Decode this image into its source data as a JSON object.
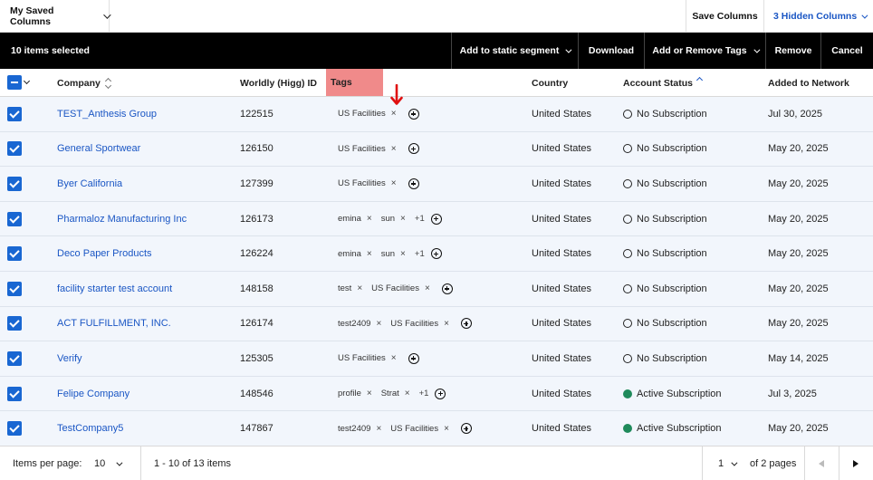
{
  "toolbar": {
    "saved_columns": "My Saved Columns",
    "save_columns": "Save Columns",
    "hidden_columns": "3 Hidden Columns"
  },
  "actionbar": {
    "selected_count": "10 items selected",
    "add_to_segment": "Add to static segment",
    "download": "Download",
    "add_remove_tags": "Add or Remove Tags",
    "remove": "Remove",
    "cancel": "Cancel"
  },
  "columns": {
    "company": "Company",
    "worldly_id": "Worldly (Higg) ID",
    "tags": "Tags",
    "country": "Country",
    "account_status": "Account Status",
    "added": "Added to Network"
  },
  "rows": [
    {
      "company": "TEST_Anthesis Group",
      "id": "122515",
      "tags": [
        "US Facilities"
      ],
      "more": "",
      "country": "United States",
      "status": "No Subscription",
      "status_type": "none",
      "added": "Jul 30, 2025"
    },
    {
      "company": "General Sportwear",
      "id": "126150",
      "tags": [
        "US Facilities"
      ],
      "more": "",
      "country": "United States",
      "status": "No Subscription",
      "status_type": "none",
      "added": "May 20, 2025"
    },
    {
      "company": "Byer California",
      "id": "127399",
      "tags": [
        "US Facilities"
      ],
      "more": "",
      "country": "United States",
      "status": "No Subscription",
      "status_type": "none",
      "added": "May 20, 2025"
    },
    {
      "company": "Pharmaloz Manufacturing Inc",
      "id": "126173",
      "tags": [
        "emina",
        "sun"
      ],
      "more": "+1",
      "country": "United States",
      "status": "No Subscription",
      "status_type": "none",
      "added": "May 20, 2025"
    },
    {
      "company": "Deco Paper Products",
      "id": "126224",
      "tags": [
        "emina",
        "sun"
      ],
      "more": "+1",
      "country": "United States",
      "status": "No Subscription",
      "status_type": "none",
      "added": "May 20, 2025"
    },
    {
      "company": "facility starter test account",
      "id": "148158",
      "tags": [
        "test",
        "US Facilities"
      ],
      "more": "",
      "country": "United States",
      "status": "No Subscription",
      "status_type": "none",
      "added": "May 20, 2025"
    },
    {
      "company": "ACT FULFILLMENT, INC.",
      "id": "126174",
      "tags": [
        "test2409",
        "US Facilities"
      ],
      "more": "",
      "country": "United States",
      "status": "No Subscription",
      "status_type": "none",
      "added": "May 20, 2025"
    },
    {
      "company": "Verify",
      "id": "125305",
      "tags": [
        "US Facilities"
      ],
      "more": "",
      "country": "United States",
      "status": "No Subscription",
      "status_type": "none",
      "added": "May 14, 2025"
    },
    {
      "company": "Felipe Company",
      "id": "148546",
      "tags": [
        "profile",
        "Strat"
      ],
      "more": "+1",
      "country": "United States",
      "status": "Active Subscription",
      "status_type": "active",
      "added": "Jul 3, 2025"
    },
    {
      "company": "TestCompany5",
      "id": "147867",
      "tags": [
        "test2409",
        "US Facilities"
      ],
      "more": "",
      "country": "United States",
      "status": "Active Subscription",
      "status_type": "active",
      "added": "May 20, 2025"
    }
  ],
  "footer": {
    "items_per_page_label": "Items per page:",
    "items_per_page_value": "10",
    "range": "1 - 10 of 13 items",
    "page": "1",
    "of_pages": "of 2 pages"
  },
  "colors": {
    "accent": "#1967d2",
    "link": "#1a56c4",
    "tags_header_highlight": "#f08a8a",
    "annotation_arrow": "#e01010",
    "active_status": "#1f8a5b"
  }
}
